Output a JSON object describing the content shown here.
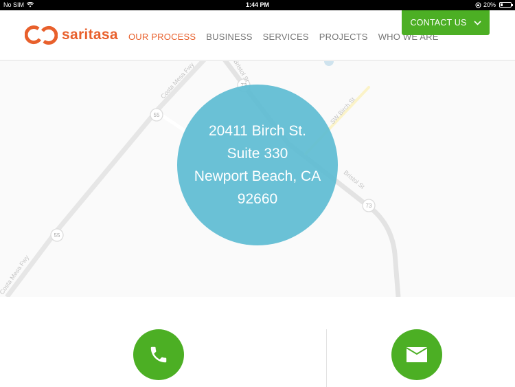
{
  "status_bar": {
    "carrier": "No SIM",
    "time": "1:44 PM",
    "battery_percent": "20%",
    "battery_level": 0.2
  },
  "header": {
    "logo_text": "saritasa",
    "nav": [
      {
        "label": "OUR PROCESS",
        "active": true
      },
      {
        "label": "BUSINESS",
        "active": false
      },
      {
        "label": "SERVICES",
        "active": false
      },
      {
        "label": "PROJECTS",
        "active": false
      },
      {
        "label": "WHO WE ARE",
        "active": false
      }
    ],
    "contact_button": "CONTACT US"
  },
  "map": {
    "labels": {
      "costa_mesa_fwy_top": "Costa Mesa Fwy",
      "costa_mesa_fwy_bottom": "Costa Mesa Fwy",
      "bristol_top": "Bristol St",
      "bristol_bottom": "Bristol St",
      "sw_birch": "SW Birch St"
    },
    "shields": {
      "route55_top": "55",
      "route55_bottom": "55",
      "route73_top": "73",
      "route73_bottom": "73"
    }
  },
  "address": {
    "line1": "20411 Birch St.",
    "line2": "Suite 330",
    "line3": "Newport Beach, CA",
    "line4": "92660"
  },
  "colors": {
    "brand_orange": "#e8602c",
    "brand_green": "#4caf24",
    "address_circle": "#5fbcd3"
  },
  "icons": {
    "phone": "phone-icon",
    "mail": "mail-icon"
  }
}
